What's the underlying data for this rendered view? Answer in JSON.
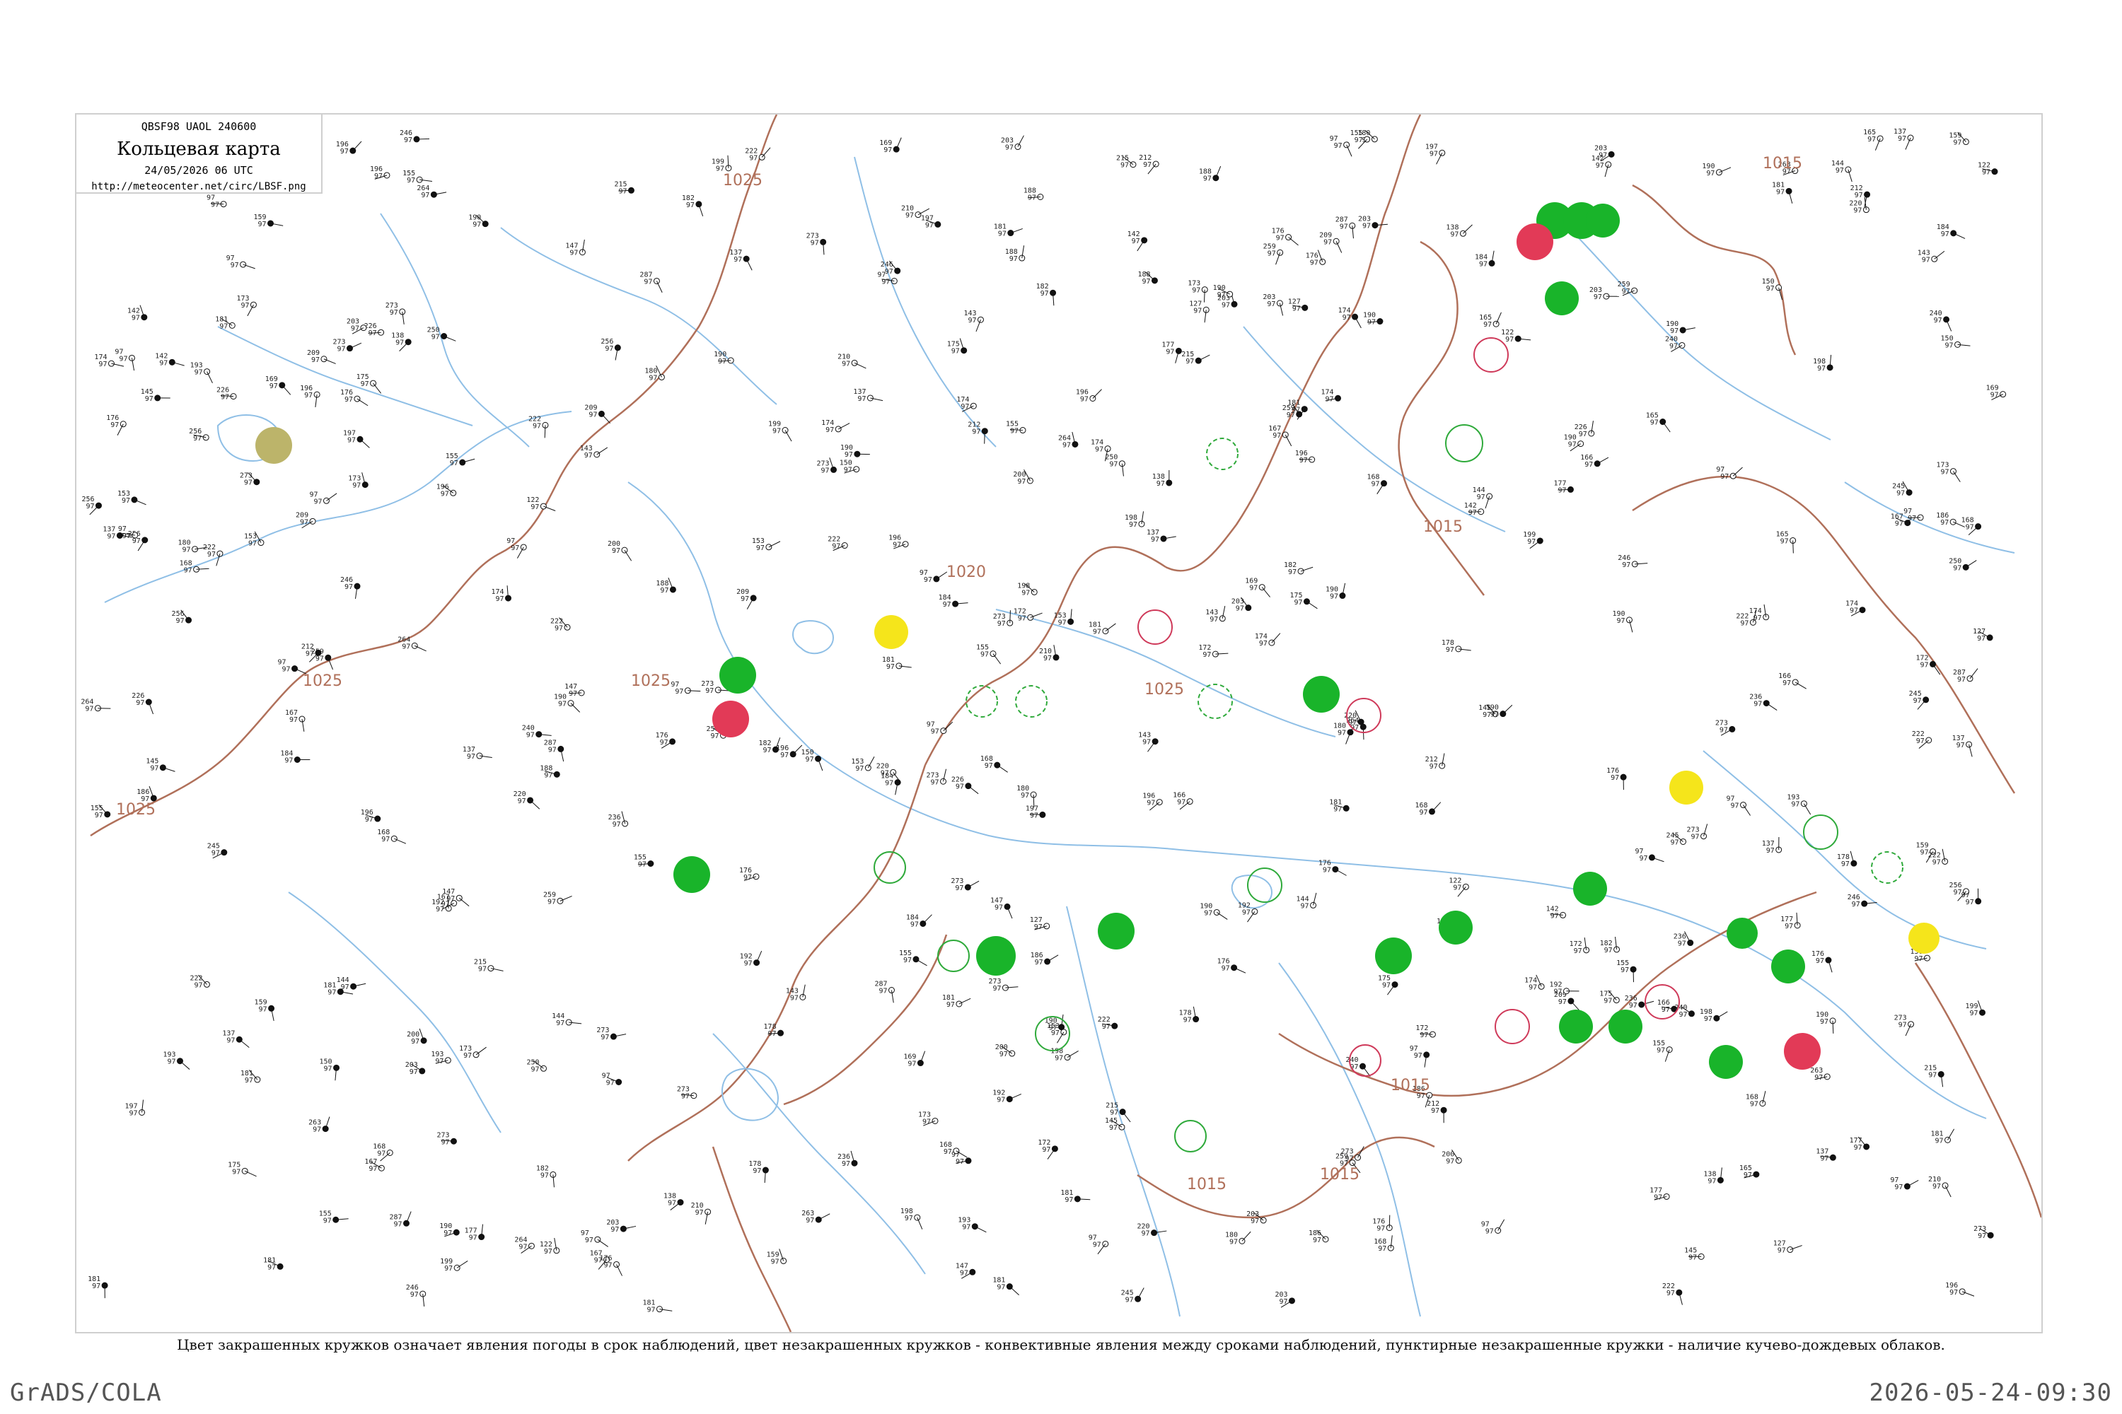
{
  "header": {
    "code_line": "QBSF98  UAOL  240600",
    "title": "Кольцевая карта",
    "date_line": "24/05/2026 06 UTC",
    "url": "http://meteocenter.net/circ/LBSF.png"
  },
  "caption": "Цвет закрашенных кружков означает явления погоды в срок наблюдений, цвет незакрашенных кружков - конвективные явления между сроками наблюдений, пунктирные незакрашенные кружки - наличие кучево-дождевых облаков.",
  "footer": {
    "left": "GrADS/COLA",
    "right": "2026-05-24-09:30"
  },
  "colors": {
    "isobar": "#b0705a",
    "rivers": "#8fbfe6",
    "rain_fill": "#19b42a",
    "storm_fill": "#e23a57",
    "fog_fill": "#f5e51b",
    "haze_fill": "#bcb46a",
    "outline_green": "#2faa3b",
    "outline_red": "#cf3a5a"
  },
  "isobar_labels": [
    "1025",
    "1025",
    "1025",
    "1025",
    "1020",
    "1015",
    "1015",
    "1015",
    "1015",
    "1015"
  ],
  "station_values": [
    "180",
    "97",
    "143",
    "287",
    "190",
    "264",
    "259",
    "184",
    "246",
    "198",
    "153",
    "182",
    "203",
    "176",
    "256",
    "97",
    "173",
    "209",
    "273",
    "177",
    "212",
    "174",
    "167",
    "172",
    "97",
    "150",
    "142",
    "273",
    "155",
    "215",
    "188",
    "222",
    "203",
    "176",
    "273",
    "181",
    "122",
    "175",
    "196",
    "97",
    "181",
    "220",
    "147",
    "186",
    "245",
    "197",
    "190",
    "210",
    "168",
    "174",
    "137",
    "222",
    "192",
    "138",
    "240",
    "193",
    "155",
    "199",
    "226",
    "137",
    "181",
    "250",
    "145",
    "127",
    "190",
    "144",
    "200",
    "178",
    "236",
    "159",
    "196",
    "166",
    "169",
    "263",
    "168",
    "165"
  ]
}
